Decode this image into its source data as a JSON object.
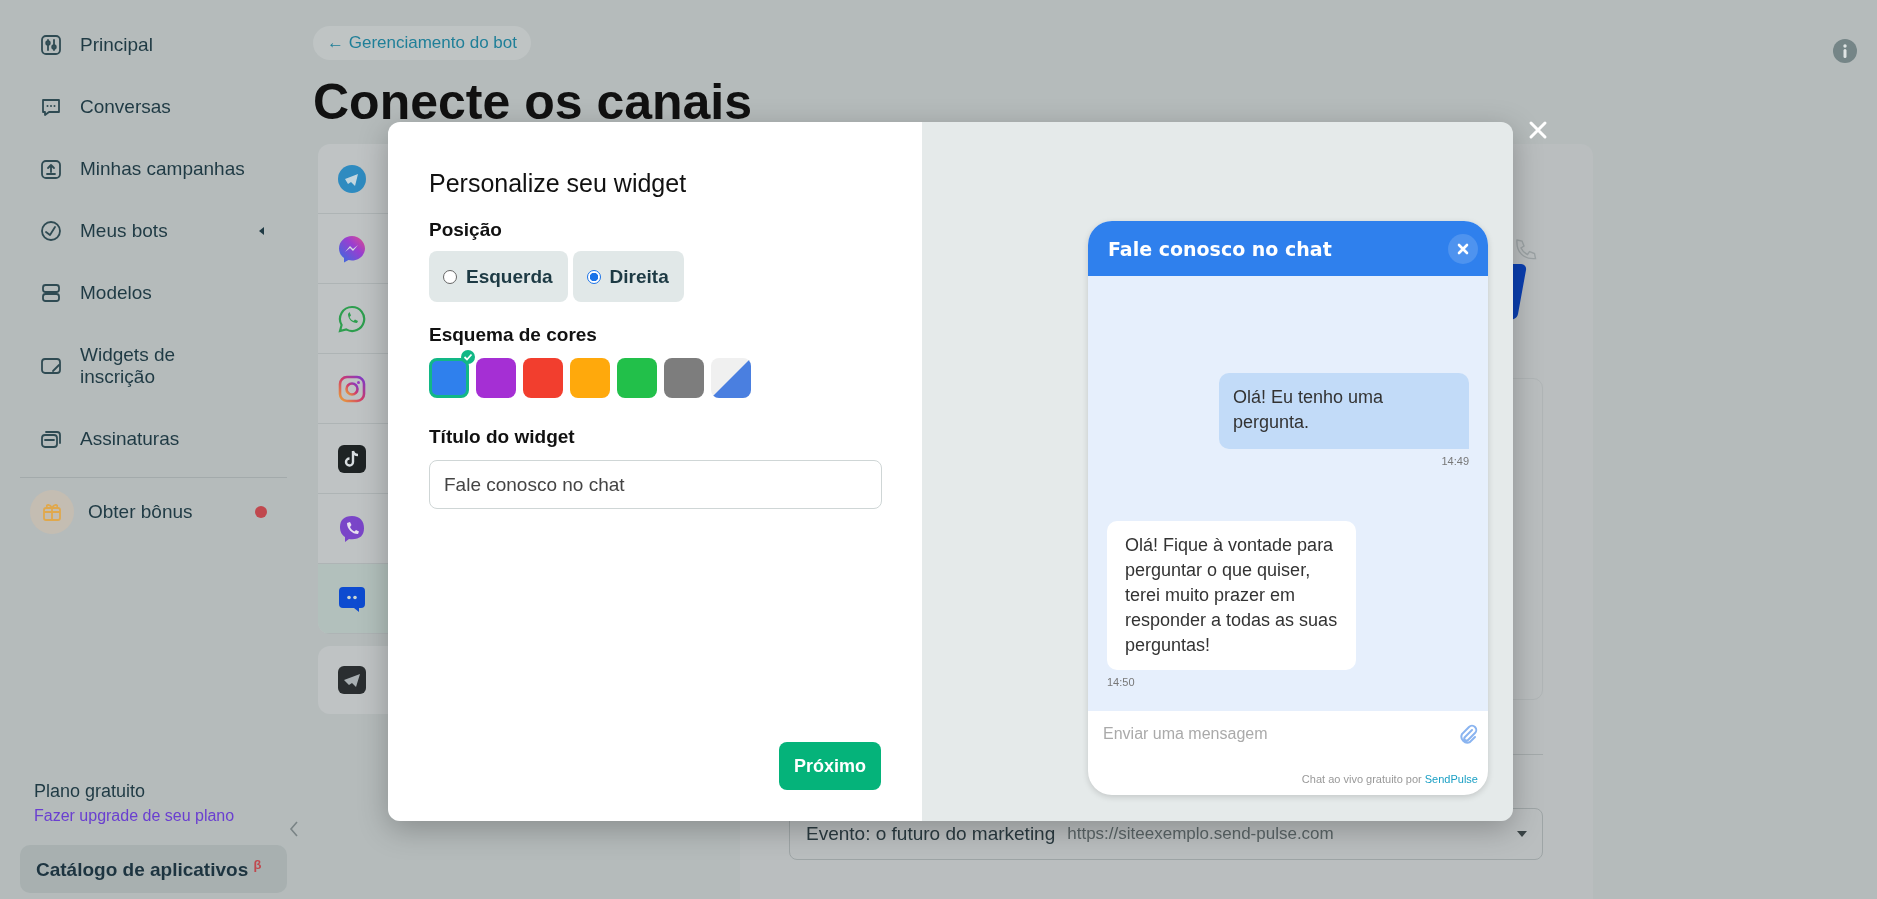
{
  "sidebar": {
    "items": [
      {
        "label": "Principal"
      },
      {
        "label": "Conversas"
      },
      {
        "label": "Minhas campanhas"
      },
      {
        "label": "Meus bots"
      },
      {
        "label": "Modelos"
      },
      {
        "label": "Widgets de inscrição"
      },
      {
        "label": "Assinaturas"
      }
    ],
    "bonus": {
      "label": "Obter bônus",
      "notification": true
    },
    "plan": {
      "name": "Plano gratuito",
      "upgrade_link": "Fazer upgrade de seu plano"
    },
    "catalog_button": {
      "label": "Catálogo de aplicativos",
      "superscript": "β"
    }
  },
  "breadcrumb": "← Gerenciamento do bot",
  "page_title": "Conecte os canais",
  "channels": [
    {
      "selected": false
    },
    {
      "selected": false
    },
    {
      "selected": false
    },
    {
      "selected": false
    },
    {
      "selected": false
    },
    {
      "selected": false
    },
    {
      "selected": true
    }
  ],
  "event_select": {
    "value": "Evento: o futuro do marketing",
    "url": "https://siteexemplo.send-pulse.com"
  },
  "modal": {
    "heading": "Personalize seu widget",
    "position": {
      "label": "Posição",
      "options": [
        {
          "label": "Esquerda",
          "selected": false
        },
        {
          "label": "Direita",
          "selected": true
        }
      ]
    },
    "color_scheme": {
      "label": "Esquema de cores",
      "swatches": [
        {
          "kind": "solid",
          "color": "#2f80ed",
          "selected": true
        },
        {
          "kind": "solid",
          "color": "#a52fd4",
          "selected": false
        },
        {
          "kind": "solid",
          "color": "#f23e2e",
          "selected": false
        },
        {
          "kind": "solid",
          "color": "#ffa90c",
          "selected": false
        },
        {
          "kind": "solid",
          "color": "#22c04a",
          "selected": false
        },
        {
          "kind": "solid",
          "color": "#7d7d7d",
          "selected": false
        },
        {
          "kind": "split",
          "color": "#4a7fe0",
          "selected": false
        }
      ]
    },
    "title_field": {
      "label": "Título do widget",
      "value": "Fale conosco no chat"
    },
    "next_button": "Próximo"
  },
  "preview": {
    "title": "Fale conosco no chat",
    "messages": [
      {
        "kind": "outgoing",
        "text": "Olá! Eu tenho uma pergunta.",
        "time": "14:49"
      },
      {
        "kind": "incoming",
        "text": "Olá! Fique à vontade para perguntar o que quiser, terei muito prazer em responder a todas as suas perguntas!",
        "time": "14:50"
      }
    ],
    "input": {
      "placeholder": "Enviar uma mensagem"
    },
    "footer": {
      "text": "Chat ao vivo gratuito por",
      "brand": "SendPulse"
    }
  }
}
